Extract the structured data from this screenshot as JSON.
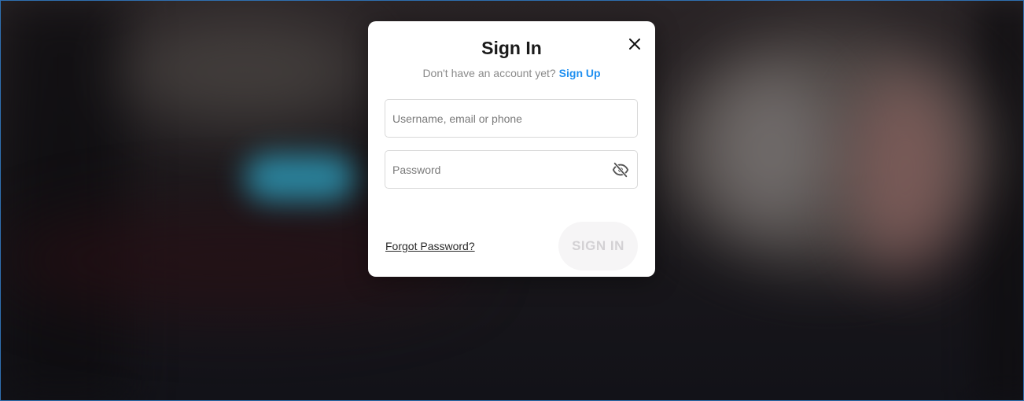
{
  "modal": {
    "title": "Sign In",
    "subtitle_text": "Don't have an account yet?",
    "signup_link": "Sign Up",
    "username_placeholder": "Username, email or phone",
    "password_placeholder": "Password",
    "forgot_password": "Forgot Password?",
    "signin_button": "SIGN IN"
  },
  "icons": {
    "close": "close-icon",
    "password_toggle": "eye-off-icon"
  },
  "colors": {
    "accent_link": "#1f8ff0",
    "button_disabled_bg": "#f6f5f6",
    "button_disabled_text": "#d3d1d4"
  }
}
